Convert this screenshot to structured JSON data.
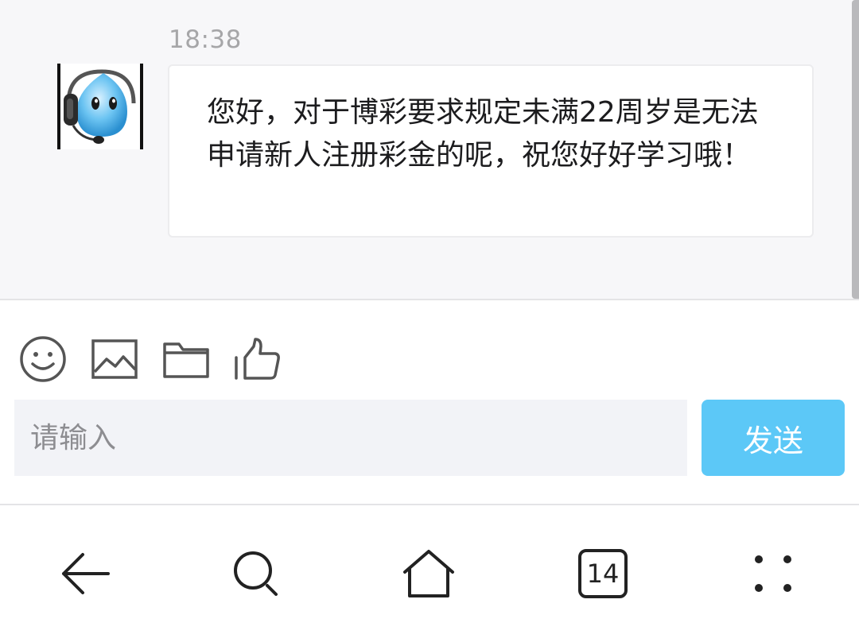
{
  "chat": {
    "timestamp": "18:38",
    "message": "您好，对于博彩要求规定未满22周岁是无法申请新人注册彩金的呢，祝您好好学习哦！"
  },
  "toolbar": {
    "icons": [
      "emoji-icon",
      "image-icon",
      "folder-icon",
      "thumbs-up-icon"
    ]
  },
  "composer": {
    "placeholder": "请输入",
    "send_label": "发送"
  },
  "nav": {
    "tab_count": "14",
    "icons": [
      "back-arrow-icon",
      "search-icon",
      "home-icon",
      "tabs-icon",
      "menu-dots-icon"
    ]
  },
  "colors": {
    "send_button": "#5cc8f7",
    "input_background": "#f2f3f7",
    "chat_background": "#f7f7f9"
  }
}
